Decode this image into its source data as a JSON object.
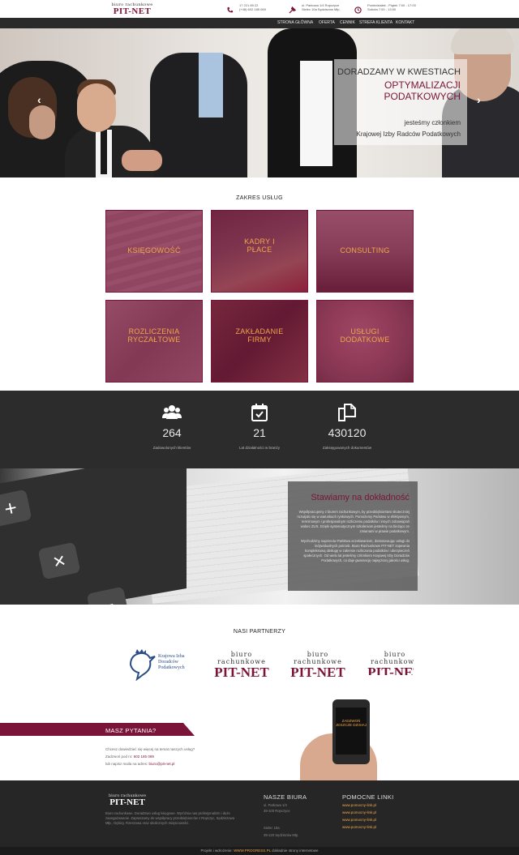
{
  "header": {
    "logo_top": "biuro rachunkowe",
    "logo_main": "PIT-NET",
    "phone_line1": "17 221 89 22",
    "phone_line2": "(+48) 602 185 069",
    "address_line1": "ul. Parkowa 1/4 Ropczyce",
    "address_line2": "Sielec 10a Sędziszów Młp.",
    "hours_line1": "Poniedziałek - Piątek 7:00 - 17:00",
    "hours_line2": "Sobota 7:00 - 13:00"
  },
  "nav": [
    "STRONA GŁÓWNA",
    "OFERTA",
    "CENNIK",
    "STREFA KLIENTA",
    "KONTAKT"
  ],
  "hero": {
    "line1": "DORADZAMY W KWESTIACH",
    "line2": "OPTYMALIZACJI PODATKOWYCH",
    "line3": "jesteśmy członkiem",
    "line4": "Krajowej Izby Radców Podatkowych"
  },
  "services": {
    "title": "ZAKRES USŁUG",
    "items": [
      {
        "line1": "KSIĘGOWOŚĆ",
        "line2": ""
      },
      {
        "line1": "KADRY I",
        "line2": "PŁACE"
      },
      {
        "line1": "CONSULTING",
        "line2": ""
      },
      {
        "line1": "ROZLICZENIA",
        "line2": "RYCZAŁTOWE"
      },
      {
        "line1": "ZAKŁADANIE",
        "line2": "FIRMY"
      },
      {
        "line1": "USŁUGI",
        "line2": "DODATKOWE"
      }
    ]
  },
  "stats": [
    {
      "value": "264",
      "caption": "Zadowolonych klientów",
      "icon": "users-icon"
    },
    {
      "value": "21",
      "caption": "Lat działalności w branży",
      "icon": "calendar-check-icon"
    },
    {
      "value": "430120",
      "caption": "Zaksięgowanych dokumentów",
      "icon": "documents-icon"
    }
  ],
  "precision": {
    "title": "Stawiamy na dokładność",
    "para1": "Współpracujemy z biurem rachunkowym, by przedsiębiorstwo skuteczniej rozwijało się w warunkach rynkowych. Pomożemy Państwu w efektywnym, terminowym i profesjonalnym rozliczeniu podatków i innych zobowiązań wobec ZUS. Dzięki systematycznym szkoleniom jesteśmy na bieżąco ze zmianami w prawie podatkowym.",
    "para2": "Wychodzimy naprzeciw Państwa oczekiwaniom, dostosowując usługi do indywidualnych potrzeb. Biuro Rachunkowe PIT-NET zapewnia kompleksową obsługę w zakresie rozliczania podatków i ubezpieczeń społecznych. Od wielu lat jesteśmy członkiem Krajowej Izby Doradców Podatkowych, co daje gwarancję najwyższej jakości usług."
  },
  "partners": {
    "title": "NASI PARTNERZY",
    "kidp_line1": "Krajowa Izba",
    "kidp_line2": "Doradców",
    "kidp_line3": "Podatkowych",
    "pitnet_small": "biuro rachunkowe",
    "pitnet_big": "PIT-NET"
  },
  "questions": {
    "title": "MASZ PYTANIA?",
    "line1": "Chcesz dowiedzieć się więcej na temat naszych usług?",
    "line2_prefix": "Zadzwoń pod nr:",
    "phone": "602 185 069",
    "line3_prefix": "lub napisz maila na adres:",
    "email": "biuro@pit-net.pl",
    "phone_screen": "ZADZWOŃ JESZCZE DZISIAJ"
  },
  "footer": {
    "logo_top": "biuro rachunkowe",
    "logo_main": "PIT-NET",
    "about": "Biuro rachunkowe. Doradztwo usług księgowe. Wyróżnia nas profesjonalizm i duże zaangażowanie. Zapraszamy do współpracy przedsiębiorców z Ropczyc, Sędziszowa Młp., Dębicy, Rzeszowa oraz okolicznych miejscowości.",
    "offices_title": "NASZE BIURA",
    "office1_l1": "ul. Parkowa 1/4",
    "office1_l2": "39-100 Ropczyce",
    "office2_l1": "Sielec 10a",
    "office2_l2": "39-120 Sędziszów Młp.",
    "links_title": "POMOCNE LINKI",
    "links": [
      "www.pomocny-link.pl",
      "www.pomocny-link.pl",
      "www.pomocny-link.pl",
      "www.pomocny-link.pl"
    ],
    "copyright_prefix": "Projekt i wdrożenie:",
    "copyright_brand": "WWW.PROGRESS.PL",
    "copyright_suffix": "dokładnie strony internetowe"
  },
  "colors": {
    "brand": "#7a1438",
    "accent": "#f0a74a",
    "dark": "#2c2c2c"
  }
}
